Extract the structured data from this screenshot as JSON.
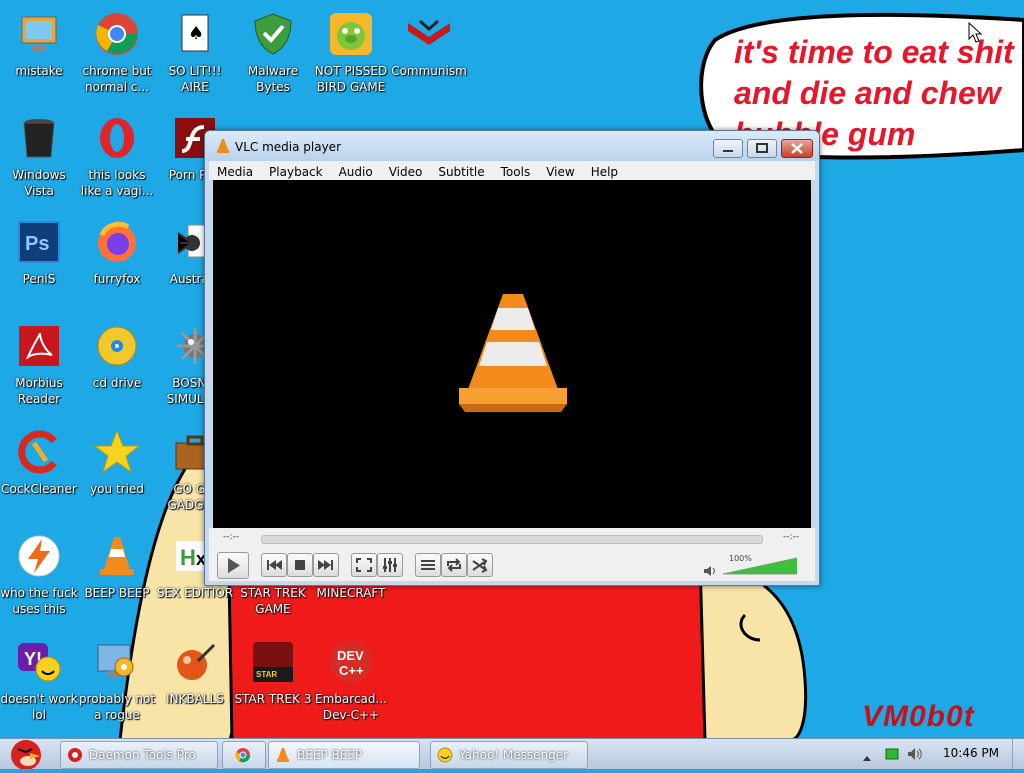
{
  "desktop": {
    "speech_text": "it's time to eat shit\nand die and chew\nbubble gum",
    "watermark": "VM0b0t",
    "icons": [
      {
        "label": "mistake",
        "icon": "computer-icon"
      },
      {
        "label": "chrome but normal c...",
        "icon": "chrome-icon"
      },
      {
        "label": "SO LIT!!! AIRE",
        "icon": "cards-icon"
      },
      {
        "label": "Malware Bytes",
        "icon": "shield-icon"
      },
      {
        "label": "NOT PISSED BIRD GAME",
        "icon": "pig-icon"
      },
      {
        "label": "Communism",
        "icon": "emblem-icon"
      },
      {
        "label": "Windows Vista",
        "icon": "trash-icon"
      },
      {
        "label": "this looks like a vagi...",
        "icon": "opera-icon"
      },
      {
        "label": "Porn Pl...",
        "icon": "flash-icon"
      },
      {
        "label": "PeniS",
        "icon": "photoshop-icon"
      },
      {
        "label": "furryfox",
        "icon": "firefox-icon"
      },
      {
        "label": "Austra...",
        "icon": "spider-icon"
      },
      {
        "label": "Morbius Reader",
        "icon": "pdf-icon"
      },
      {
        "label": "cd drive",
        "icon": "cd-icon"
      },
      {
        "label": "BOSN... SIMULA...",
        "icon": "mine-icon"
      },
      {
        "label": "CockCleaner",
        "icon": "ccleaner-icon"
      },
      {
        "label": "you tried",
        "icon": "star-icon"
      },
      {
        "label": "GO G... GADGE...",
        "icon": "briefcase-icon"
      },
      {
        "label": "who the fuck uses this",
        "icon": "bolt-icon"
      },
      {
        "label": "BEEP BEEP",
        "icon": "vlc-cone-icon"
      },
      {
        "label": "SEX EDITIOR",
        "icon": "hex-icon"
      },
      {
        "label": "STAR TREK GAME",
        "icon": "startrek-icon"
      },
      {
        "label": "MINECRAFT",
        "icon": "minecraft-icon"
      },
      {
        "label": "doesn't work lol",
        "icon": "yahoo-icon"
      },
      {
        "label": "probably not a rogue",
        "icon": "settings-monitor-icon"
      },
      {
        "label": "INKBALLS",
        "icon": "inkball-icon"
      },
      {
        "label": "STAR TREK 3",
        "icon": "startrek3-icon"
      },
      {
        "label": "Embarcad... Dev-C++",
        "icon": "devcpp-icon"
      }
    ]
  },
  "vlc": {
    "title": "VLC media player",
    "menu": [
      "Media",
      "Playback",
      "Audio",
      "Video",
      "Subtitle",
      "Tools",
      "View",
      "Help"
    ],
    "time_elapsed": "--:--",
    "time_total": "--:--",
    "volume_label": "100%",
    "volume_level": 1.0
  },
  "taskbar": {
    "items": [
      {
        "label": "Daemon Tools Pro",
        "icon": "daemon-icon"
      },
      {
        "label": "",
        "icon": "chrome-icon"
      },
      {
        "label": "BEEP BEEP",
        "icon": "vlc-cone-icon"
      },
      {
        "label": "Yahoo! Messenger",
        "icon": "yahoo-icon"
      }
    ],
    "clock": "10:46 PM"
  },
  "colors": {
    "desktop_bg": "#1ea8e6",
    "accent_red": "#e8162a",
    "vlc_orange": "#f28a1c"
  }
}
